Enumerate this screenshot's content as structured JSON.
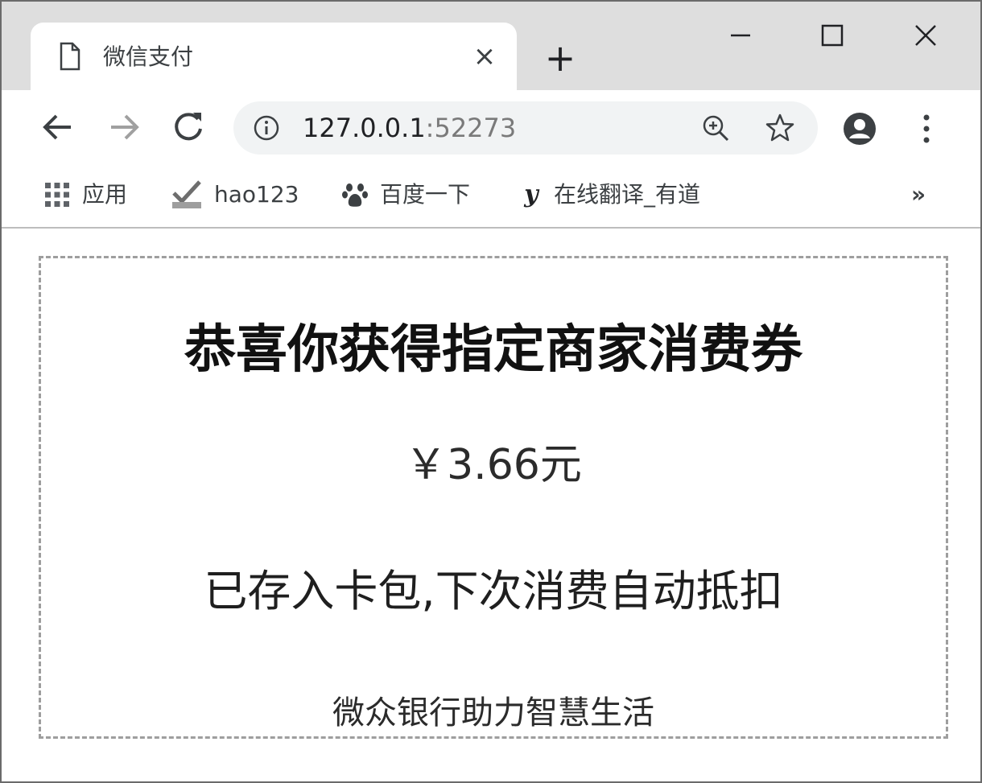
{
  "tab": {
    "title": "微信支付",
    "close_label": "×",
    "new_tab_label": "+"
  },
  "toolbar": {
    "url_host": "127.0.0.1",
    "url_port": ":52273"
  },
  "bookmarks": {
    "items": [
      {
        "label": "应用",
        "icon": "apps-grid-icon"
      },
      {
        "label": "hao123",
        "icon": "hao123-logo-icon"
      },
      {
        "label": "百度一下",
        "icon": "baidu-paw-icon"
      },
      {
        "label": "在线翻译_有道",
        "icon": "youdao-logo-icon"
      }
    ],
    "more_label": "»"
  },
  "coupon": {
    "headline": "恭喜你获得指定商家消费券",
    "amount": "￥3.66元",
    "notice": "已存入卡包,下次消费自动抵扣",
    "slogan": "微众银行助力智慧生活"
  }
}
